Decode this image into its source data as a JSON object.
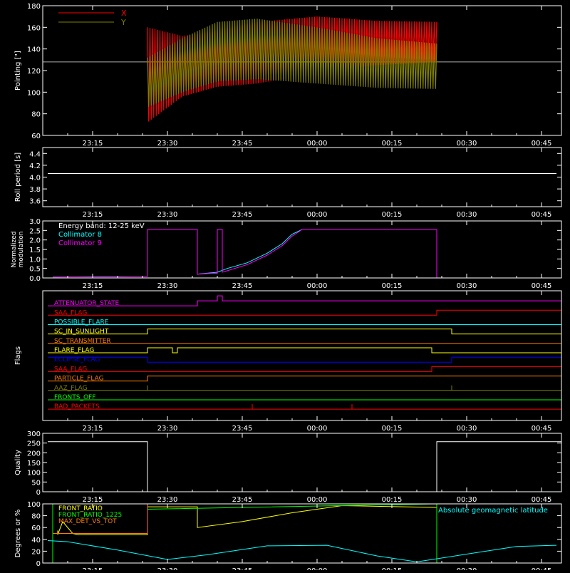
{
  "figure": {
    "background": "#000000",
    "foreground": "#ffffff"
  },
  "time_ticks": [
    "23:15",
    "23:30",
    "23:45",
    "00:00",
    "00:15",
    "00:30",
    "00:45"
  ],
  "chart_data": [
    {
      "id": "pointing",
      "type": "line",
      "ylabel": "Pointing [\"]",
      "ylim": [
        60,
        180
      ],
      "yticks": [
        60,
        80,
        100,
        120,
        140,
        160,
        180
      ],
      "xlim": [
        "23:05",
        "00:49"
      ],
      "reference_line": 128,
      "data_range": [
        "23:26",
        "00:24"
      ],
      "legend": {
        "placement": "top-left"
      },
      "series": [
        {
          "name": "X",
          "color": "#ff0000",
          "upper": [
            160,
            152,
            157,
            165,
            170,
            166,
            165
          ],
          "lower": [
            72,
            96,
            105,
            108,
            118,
            125,
            128
          ]
        },
        {
          "name": "Y",
          "color": "#808000",
          "upper": [
            132,
            150,
            165,
            168,
            160,
            150,
            145
          ],
          "lower": [
            86,
            100,
            110,
            112,
            108,
            104,
            103
          ]
        }
      ],
      "band_x": [
        "23:26",
        "23:33",
        "23:40",
        "23:48",
        "00:00",
        "00:12",
        "00:24"
      ]
    },
    {
      "id": "roll",
      "type": "line",
      "ylabel": "Roll period [s]",
      "ylim": [
        3.5,
        4.5
      ],
      "yticks": [
        3.6,
        3.8,
        4.0,
        4.2,
        4.4
      ],
      "xlim": [
        "23:05",
        "00:49"
      ],
      "series": [
        {
          "color": "#ffffff",
          "x": [
            "23:06",
            "00:48"
          ],
          "y": [
            4.06,
            4.06
          ]
        }
      ]
    },
    {
      "id": "modulation",
      "type": "line",
      "ylabel": "Normalized modulation",
      "ylim": [
        0,
        3
      ],
      "yticks": [
        0.0,
        0.5,
        1.0,
        1.5,
        2.0,
        2.5,
        3.0
      ],
      "xlim": [
        "23:05",
        "00:49"
      ],
      "annotation": "Energy band: 12-25 keV",
      "legend": {
        "placement": "top-left"
      },
      "series": [
        {
          "name": "Collimator 8",
          "color": "#00ffff",
          "x": [
            "23:07",
            "23:26",
            "23:26",
            "23:36",
            "23:36",
            "23:40",
            "23:42",
            "23:46",
            "23:50",
            "23:53",
            "23:55",
            "23:57",
            "00:24",
            "00:24"
          ],
          "y": [
            0.05,
            0.08,
            2.55,
            2.55,
            0.2,
            0.3,
            0.5,
            0.8,
            1.3,
            1.8,
            2.3,
            2.55,
            2.55,
            0.02
          ]
        },
        {
          "name": "Collimator 9",
          "color": "#ff00ff",
          "x": [
            "23:07",
            "23:26",
            "23:26",
            "23:36",
            "23:36",
            "23:39",
            "23:40",
            "23:40",
            "23:41",
            "23:41",
            "23:46",
            "23:50",
            "23:53",
            "23:55",
            "23:57",
            "00:24",
            "00:24"
          ],
          "y": [
            0.05,
            0.08,
            2.55,
            2.55,
            0.2,
            0.25,
            0.25,
            2.55,
            2.55,
            0.3,
            0.7,
            1.2,
            1.7,
            2.2,
            2.55,
            2.55,
            0.02
          ]
        }
      ]
    },
    {
      "id": "flags",
      "type": "step",
      "ylabel": "Flags",
      "xlim": [
        "23:05",
        "00:49"
      ],
      "flags": [
        {
          "name": "ATTENUATOR_STATE",
          "color": "#ff00ff",
          "x": [
            "23:06",
            "23:36",
            "23:36",
            "23:40",
            "23:40",
            "23:41",
            "23:41",
            "00:49"
          ],
          "y": [
            0,
            0,
            1,
            1,
            2,
            2,
            1,
            1
          ]
        },
        {
          "name": "SAA_FLAG",
          "color": "#ff0000",
          "x": [
            "23:06",
            "00:24",
            "00:24",
            "00:49"
          ],
          "y": [
            0,
            0,
            1,
            1
          ]
        },
        {
          "name": "POSSIBLE_FLARE",
          "color": "#00ffff",
          "x": [
            "23:06",
            "00:49"
          ],
          "y": [
            0,
            0
          ]
        },
        {
          "name": "SC_IN_SUNLIGHT",
          "color": "#ffff00",
          "x": [
            "23:06",
            "23:26",
            "23:26",
            "00:27",
            "00:27",
            "00:49"
          ],
          "y": [
            0,
            0,
            1,
            1,
            0,
            0
          ]
        },
        {
          "name": "SC_TRANSMITTER",
          "color": "#ff7f00",
          "x": [
            "23:06",
            "00:49"
          ],
          "y": [
            0,
            0
          ]
        },
        {
          "name": "FLARE_FLAG",
          "color": "#ffff00",
          "x": [
            "23:06",
            "23:26",
            "23:26",
            "23:31",
            "23:31",
            "23:32",
            "23:32",
            "00:23",
            "00:23",
            "00:49"
          ],
          "y": [
            0,
            0,
            1,
            1,
            0,
            0,
            1,
            1,
            0,
            0
          ]
        },
        {
          "name": "ECLIPSE_FLAG",
          "color": "#0000ff",
          "x": [
            "23:06",
            "23:26",
            "23:26",
            "00:27",
            "00:27",
            "00:49"
          ],
          "y": [
            1,
            1,
            0,
            0,
            1,
            1
          ]
        },
        {
          "name": "SAA_FLAG",
          "color": "#ff0000",
          "x": [
            "23:06",
            "00:23",
            "00:23",
            "00:49"
          ],
          "y": [
            0,
            0,
            1,
            1
          ]
        },
        {
          "name": "PARTICLE_FLAG",
          "color": "#ff7f00",
          "x": [
            "23:06",
            "23:26",
            "23:26",
            "00:49"
          ],
          "y": [
            0,
            0,
            1,
            1
          ]
        },
        {
          "name": "AAZ_FLAG",
          "color": "#808000",
          "x": [
            "23:06",
            "23:26",
            "23:26",
            "23:26",
            "23:26",
            "00:27",
            "00:27",
            "00:27",
            "00:27",
            "00:49"
          ],
          "y": [
            0,
            0,
            1,
            1,
            0,
            0,
            1,
            1,
            0,
            0
          ]
        },
        {
          "name": "FRONTS_OFF",
          "color": "#00ff00",
          "x": [
            "23:06",
            "00:49"
          ],
          "y": [
            0,
            0
          ]
        },
        {
          "name": "BAD_PACKETS",
          "color": "#ff0000",
          "x": [
            "23:06",
            "00:49"
          ],
          "y": [
            0,
            0
          ],
          "spikes": [
            "23:47",
            "00:07"
          ]
        }
      ]
    },
    {
      "id": "quality",
      "type": "line",
      "ylabel": "Quality",
      "ylim": [
        0,
        300
      ],
      "yticks": [
        0,
        50,
        100,
        150,
        200,
        250,
        300
      ],
      "xlim": [
        "23:05",
        "00:49"
      ],
      "series": [
        {
          "color": "#ffffff",
          "x": [
            "23:06",
            "23:26",
            "23:26",
            "00:24",
            "00:24",
            "00:49"
          ],
          "y": [
            257,
            257,
            0,
            0,
            257,
            257
          ]
        }
      ]
    },
    {
      "id": "degrees",
      "type": "line",
      "ylabel": "Degrees or %",
      "ylim": [
        0,
        100
      ],
      "yticks": [
        0,
        20,
        40,
        60,
        80,
        100
      ],
      "xlim": [
        "23:05",
        "00:49"
      ],
      "legend": {
        "placement": "top-left"
      },
      "annotation": "Absolute geomagnetic latitude",
      "annotation_color": "#00ffff",
      "series": [
        {
          "name": "FRONT_RATIO",
          "color": "#ffff00",
          "x": [
            "23:08",
            "23:08",
            "23:09",
            "23:11",
            "23:12",
            "23:26",
            "23:26",
            "23:36",
            "23:36",
            "23:45",
            "23:55",
            "00:05",
            "00:24"
          ],
          "y": [
            55,
            48,
            70,
            50,
            48,
            48,
            95,
            95,
            60,
            70,
            85,
            97,
            94
          ]
        },
        {
          "name": "FRONT_RATIO_1225",
          "color": "#00ff00",
          "x": [
            "23:07",
            "23:07",
            "23:26",
            "23:26",
            "00:24",
            "00:24"
          ],
          "y": [
            0,
            100,
            100,
            91,
            100,
            0
          ]
        },
        {
          "name": "MAX_DET_VS_TOT",
          "color": "#ff7f00",
          "x": [
            "23:07",
            "23:26",
            "23:26",
            "00:49"
          ],
          "y": [
            50,
            50,
            100,
            100
          ]
        },
        {
          "name": "",
          "color": "#00ffff",
          "x": [
            "23:06",
            "23:10",
            "23:20",
            "23:30",
            "23:38",
            "23:50",
            "00:02",
            "00:12",
            "00:20",
            "00:30",
            "00:40",
            "00:48"
          ],
          "y": [
            38,
            36,
            22,
            6,
            14,
            29,
            30,
            12,
            2,
            15,
            28,
            30
          ]
        }
      ]
    }
  ]
}
